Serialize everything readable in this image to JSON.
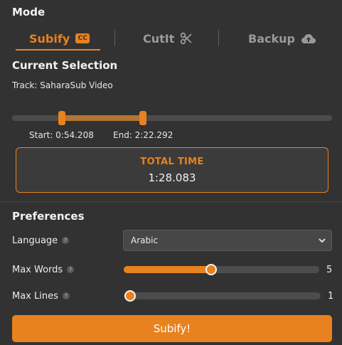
{
  "mode": {
    "title": "Mode",
    "tabs": [
      {
        "label": "Subify",
        "icon": "cc-icon",
        "icon_text": "CC",
        "active": true
      },
      {
        "label": "CutIt",
        "icon": "scissors-icon",
        "active": false
      },
      {
        "label": "Backup",
        "icon": "cloud-upload-icon",
        "active": false
      }
    ]
  },
  "selection": {
    "title": "Current Selection",
    "track_text": "Track: SaharaSub Video",
    "start_label": "Start: 0:54.208",
    "end_label": "End: 2:22.292",
    "total_label": "TOTAL TIME",
    "total_value": "1:28.083"
  },
  "preferences": {
    "title": "Preferences",
    "language": {
      "label": "Language",
      "help": "?",
      "value": "Arabic"
    },
    "max_words": {
      "label": "Max Words",
      "help": "?",
      "value": "5",
      "fraction": 0.5
    },
    "max_lines": {
      "label": "Max Lines",
      "help": "?",
      "value": "1",
      "fraction": 0.0
    }
  },
  "action": {
    "label": "Subify!"
  },
  "colors": {
    "accent": "#e8821e",
    "background": "#323232"
  }
}
